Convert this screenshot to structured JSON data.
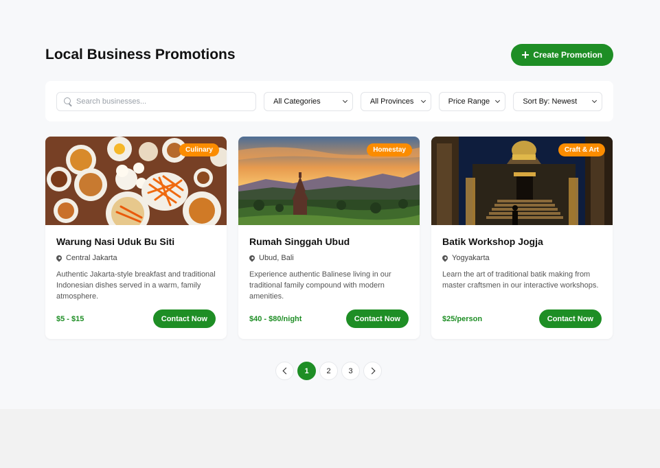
{
  "header": {
    "title": "Local Business Promotions",
    "create_label": "Create Promotion"
  },
  "filters": {
    "search_placeholder": "Search businesses...",
    "category": "All Categories",
    "province": "All Provinces",
    "price": "Price Range",
    "sort": "Sort By: Newest"
  },
  "cards": [
    {
      "badge": "Culinary",
      "title": "Warung Nasi Uduk Bu Siti",
      "location": "Central Jakarta",
      "description": "Authentic Jakarta-style breakfast and traditional Indonesian dishes served in a warm, family atmosphere.",
      "price": "$5 - $15",
      "cta": "Contact Now"
    },
    {
      "badge": "Homestay",
      "title": "Rumah Singgah Ubud",
      "location": "Ubud, Bali",
      "description": "Experience authentic Balinese living in our traditional family compound with modern amenities.",
      "price": "$40 - $80/night",
      "cta": "Contact Now"
    },
    {
      "badge": "Craft & Art",
      "title": "Batik Workshop Jogja",
      "location": "Yogyakarta",
      "description": "Learn the art of traditional batik making from master craftsmen in our interactive workshops.",
      "price": "$25/person",
      "cta": "Contact Now"
    }
  ],
  "pagination": {
    "pages": [
      "1",
      "2",
      "3"
    ],
    "current": "1"
  },
  "colors": {
    "accent": "#1e8e25",
    "badge": "#fb8c00"
  }
}
